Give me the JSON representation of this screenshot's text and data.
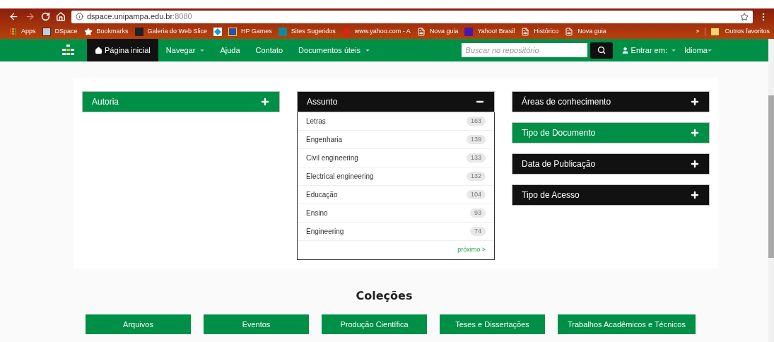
{
  "browser": {
    "url_host": "dspace.unipampa.edu.br",
    "url_port": ":8080",
    "bookmarks": [
      {
        "kind": "apps",
        "label": "Apps"
      },
      {
        "kind": "letter",
        "label": "DSpace"
      },
      {
        "kind": "star",
        "label": "Bookmarks"
      },
      {
        "kind": "slice",
        "label": "Galeria do Web Slice"
      },
      {
        "kind": "diamond"
      },
      {
        "kind": "game",
        "label": "HP Games"
      },
      {
        "kind": "bing",
        "label": "Sites Sugeridos"
      },
      {
        "kind": "yahoo-old",
        "label": "www.yahoo.com - A"
      },
      {
        "kind": "page",
        "label": "Nova guia"
      },
      {
        "kind": "yahoo",
        "label": "Yahoo! Brasil"
      },
      {
        "kind": "page",
        "label": "Histórico"
      },
      {
        "kind": "page",
        "label": "Nova guia"
      }
    ],
    "more": "»",
    "other": "Outros favoritos"
  },
  "navbar": {
    "items": [
      {
        "label": "Página inicial",
        "selected": true,
        "dropdown": false,
        "kind": "home"
      },
      {
        "label": "Navegar",
        "selected": false,
        "dropdown": true
      },
      {
        "label": "Ajuda",
        "selected": false,
        "dropdown": false
      },
      {
        "label": "Contato",
        "selected": false,
        "dropdown": false
      },
      {
        "label": "Documentos úteis",
        "selected": false,
        "dropdown": true
      }
    ],
    "search": {
      "placeholder": "Buscar no repositório"
    },
    "login": "Entrar em:",
    "language": "Idioma"
  },
  "facets": [
    [
      {
        "title": "Autoria",
        "color": "#008f47",
        "expanded": false
      }
    ],
    [
      {
        "title": "Assunto",
        "color": "#111111",
        "expanded": true,
        "items": [
          {
            "label": "Letras",
            "count": "163"
          },
          {
            "label": "Engenharia",
            "count": "139"
          },
          {
            "label": "Civil engineering",
            "count": "133"
          },
          {
            "label": "Electrical engineering",
            "count": "132"
          },
          {
            "label": "Educação",
            "count": "104"
          },
          {
            "label": "Ensino",
            "count": "93"
          },
          {
            "label": "Engineering",
            "count": "74"
          }
        ],
        "next": "próximo >"
      }
    ],
    [
      {
        "title": "Áreas de conhecimento",
        "color": "#111111",
        "expanded": false
      },
      {
        "title": "Tipo de Documento",
        "color": "#008f47",
        "expanded": false
      },
      {
        "title": "Data de Publicação",
        "color": "#111111",
        "expanded": false
      },
      {
        "title": "Tipo de Acesso",
        "color": "#111111",
        "expanded": false
      }
    ]
  ],
  "collections": {
    "title": "Coleções",
    "items": [
      "Arquivos",
      "Eventos",
      "Produção Científica",
      "Teses e Dissertações",
      "Trabalhos Acadêmicos e Técnicos"
    ]
  }
}
